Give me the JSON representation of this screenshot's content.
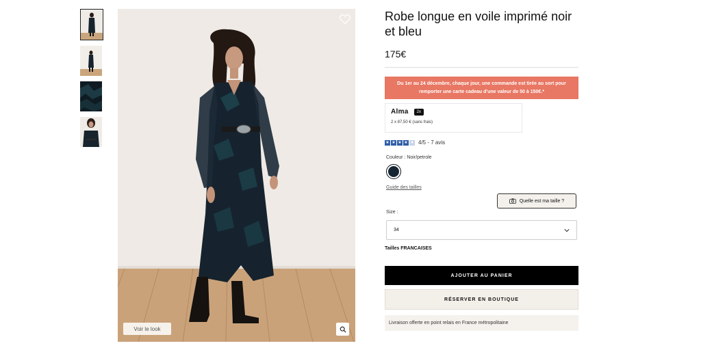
{
  "gallery": {
    "thumbnails": [
      {
        "label": "Vue de face",
        "active": true
      },
      {
        "label": "Vue de loin",
        "active": false
      },
      {
        "label": "Détail imprimé",
        "active": false
      },
      {
        "label": "Vue de près",
        "active": false
      }
    ],
    "wishlist_icon": "heart-icon",
    "look_button": "Voir le look",
    "zoom_icon": "zoom-icon"
  },
  "product": {
    "title": "Robe longue en voile imprimé noir et bleu",
    "price": "175€"
  },
  "promo": {
    "text": "Du 1er au 24 décembre, chaque jour, une commande est tirée au sort pour remporter une carte cadeau d'une valeur de 50 à 150€.*",
    "color": "#e87763"
  },
  "alma": {
    "logo": "Alma",
    "badge": "2x",
    "detail": "2 x 87,50 € (sans frais)"
  },
  "rating": {
    "stars_filled": 4,
    "stars_total": 5,
    "text": "4/5 - 7 avis",
    "color": "#2f5ea8"
  },
  "color": {
    "label": "Couleur :",
    "value": "Noir/petrole",
    "swatch": "#152531"
  },
  "size": {
    "guide_link": "Guide des tailles",
    "help_button": "Quelle est ma taille ?",
    "label": "Size :",
    "selected": "34",
    "note": "Tailles FRANCAISES"
  },
  "actions": {
    "add_to_cart": "AJOUTER AU PANIER",
    "reserve": "RÉSERVER EN BOUTIQUE"
  },
  "delivery": {
    "text": "Livraison offerte en point relais en France métropolitaine"
  }
}
